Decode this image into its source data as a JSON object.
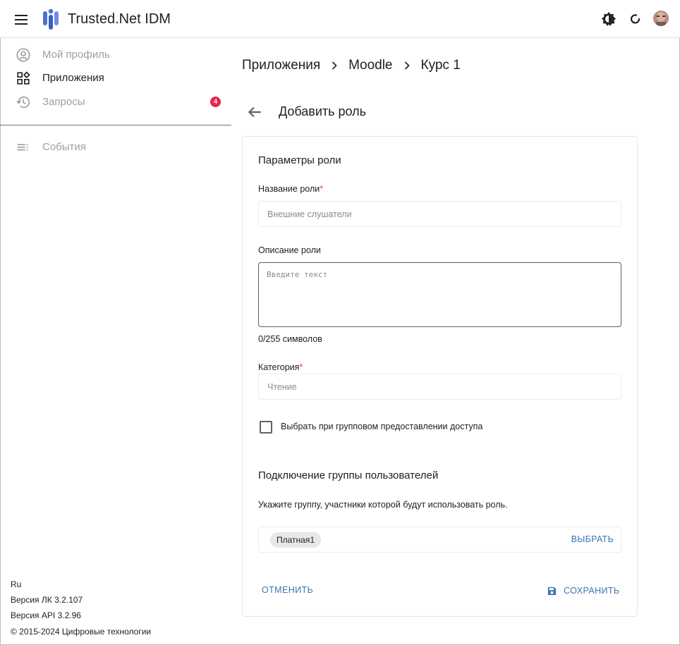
{
  "header": {
    "app_title": "Trusted.Net IDM"
  },
  "sidebar": {
    "items": [
      {
        "label": "Мой профиль",
        "icon": "account-circle-icon",
        "state": "disabled"
      },
      {
        "label": "Приложения",
        "icon": "apps-icon",
        "state": "active"
      },
      {
        "label": "Запросы",
        "icon": "history-icon",
        "state": "disabled",
        "badge": "4"
      },
      {
        "label": "События",
        "icon": "list-icon",
        "state": "disabled"
      }
    ],
    "footer": {
      "language": "Ru",
      "version_lk": "Версия ЛК 3.2.107",
      "version_api": "Версия API 3.2.96",
      "copyright": "© 2015-2024 Цифровые технологии"
    }
  },
  "breadcrumb": [
    "Приложения",
    "Moodle",
    "Курс 1"
  ],
  "page_title": "Добавить роль",
  "form": {
    "section_title": "Параметры роли",
    "role_name": {
      "label": "Название роли",
      "required_mark": "*",
      "placeholder": "Внешние слушатели",
      "value": ""
    },
    "role_description": {
      "label": "Описание роли",
      "placeholder": "Введите текст",
      "value": "",
      "counter": "0/255 символов"
    },
    "category": {
      "label": "Категория",
      "required_mark": "*",
      "placeholder": "Чтение",
      "value": ""
    },
    "group_access_checkbox": {
      "label": "Выбрать при групповом предоставлении доступа",
      "checked": false
    },
    "group_section_title": "Подключение группы пользователей",
    "group_hint": "Укажите группу, участники которой будут использовать роль.",
    "group_chip": "Платная1",
    "select_button": "ВЫБРАТЬ",
    "cancel_button": "ОТМЕНИТЬ",
    "save_button": "СОХРАНИТЬ"
  },
  "colors": {
    "accent": "#3d74b4",
    "badge": "#e8264d",
    "required": "#e53935",
    "logo_primary": "#4a6fd8"
  }
}
